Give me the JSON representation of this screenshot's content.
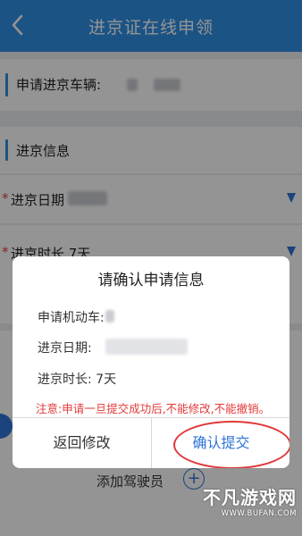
{
  "header": {
    "title": "进京证在线申领"
  },
  "vehicle_row": {
    "label": "申请进京车辆:"
  },
  "section": {
    "title": "进京信息"
  },
  "entry_date_row": {
    "label": "进京日期"
  },
  "duration_row": {
    "label": "进京时长 7天"
  },
  "dialog": {
    "title": "请确认申请信息",
    "vehicle_label": "申请机动车:",
    "date_label": "进京日期:",
    "duration_label": "进京时长: 7天",
    "notice": "注意:申请一旦提交成功后,不能修改,不能撤销。",
    "cancel_label": "返回修改",
    "confirm_label": "确认提交"
  },
  "add_driver": {
    "label": "添加驾驶员",
    "plus": "+"
  },
  "watermark": {
    "main": "不凡游戏网",
    "sub": "WWW.BUFAN.COM"
  },
  "colors": {
    "header_bg": "#2f8fe6",
    "accent": "#2f74d8",
    "warning": "#e23b3b",
    "highlight_circle": "#e0383b"
  }
}
